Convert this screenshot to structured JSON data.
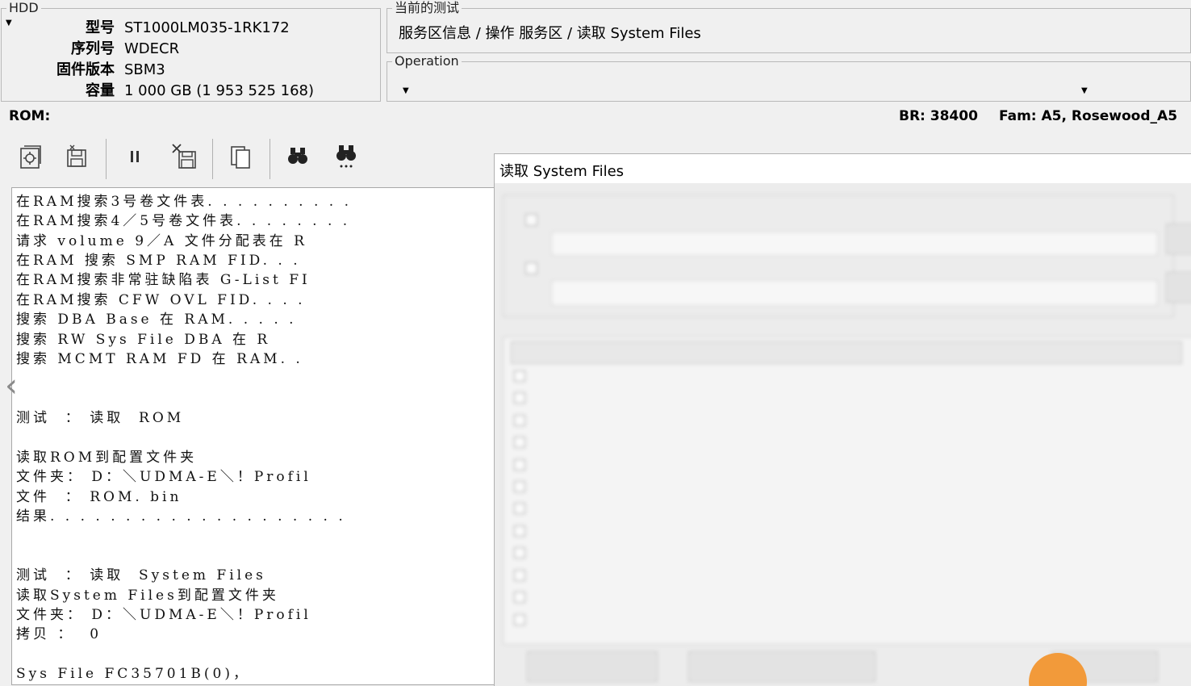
{
  "hdd_panel": {
    "legend": "HDD",
    "fields": [
      {
        "key": "型号",
        "value": "ST1000LM035-1RK172"
      },
      {
        "key": "序列号",
        "value": "WDECR"
      },
      {
        "key": "固件版本",
        "value": "SBM3"
      },
      {
        "key": "容量",
        "value": "1 000 GB (1 953 525 168)"
      }
    ]
  },
  "current_test": {
    "legend": "当前的测试",
    "value": "服务区信息 / 操作 服务区 / 读取 System Files"
  },
  "operation": {
    "legend": "Operation",
    "value": ""
  },
  "status": {
    "rom_label": "ROM:",
    "br": "BR: 38400",
    "fam": "Fam: A5, Rosewood_A5"
  },
  "toolbar": {
    "buttons": [
      "start-icon",
      "save-icon",
      "pause-icon",
      "cancel-save-icon",
      "copy-icon",
      "find-icon",
      "find-next-icon"
    ]
  },
  "log": {
    "lines": [
      "在RAM搜索3号卷文件表. . . . . . . . . .",
      "在RAM搜索4／5号卷文件表. . . . . . . .",
      "请求 volume 9／A 文件分配表在 R",
      "在RAM 搜索 SMP RAM FID. . .",
      "在RAM搜索非常驻缺陷表 G-List FI",
      "在RAM搜索 CFW OVL FID. . . .",
      "搜索 DBA Base 在 RAM. . . . .",
      "搜索 RW Sys File DBA 在 R",
      "搜索 MCMT RAM FD 在 RAM. .",
      "",
      "",
      "测试  ： 读取  ROM",
      "",
      "读取ROM到配置文件夹",
      "文件夹： D：＼UDMA-E＼！Profil",
      "文件  ： ROM. bin",
      "结果. . . . . . . . . . . . . . . . . . . .",
      "",
      "",
      "测试  ： 读取  System Files",
      "读取System Files到配置文件夹",
      "文件夹： D：＼UDMA-E＼！Profil",
      "拷贝 ：  0",
      "",
      "Sys File FC35701B(0)，"
    ]
  },
  "dialog": {
    "title": "读取 System Files"
  }
}
